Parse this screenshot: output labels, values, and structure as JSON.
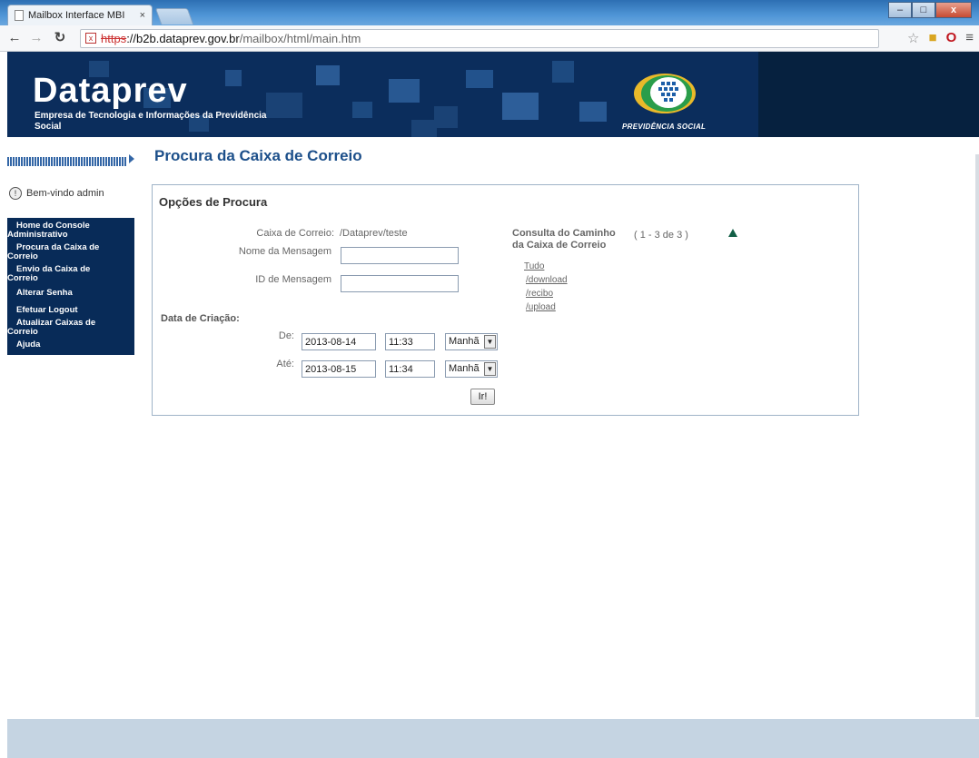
{
  "browser": {
    "tab_title": "Mailbox Interface MBI",
    "tab_close": "×",
    "url_scheme": "https",
    "url_host": "://b2b.dataprev.gov.br",
    "url_path": "/mailbox/html/main.htm",
    "window_controls": [
      "–",
      "□",
      "x"
    ]
  },
  "banner": {
    "brand": "Dataprev",
    "subtitle": "Empresa de Tecnologia e Informações da Previdência Social",
    "partner": "PREVIDÊNCIA SOCIAL"
  },
  "sidebar": {
    "welcome": "Bem-vindo admin",
    "items": [
      {
        "label": "Home do Console Administrativo"
      },
      {
        "label": "Procura da Caixa de Correio"
      },
      {
        "label": "Envio da Caixa de Correio"
      },
      {
        "label": "Alterar Senha"
      },
      {
        "label": "Efetuar Logout"
      },
      {
        "label": "Atualizar Caixas de Correio"
      },
      {
        "label": "Ajuda"
      }
    ]
  },
  "main": {
    "title": "Procura da Caixa de Correio",
    "panel_title": "Opções de Procura",
    "mailbox_label": "Caixa de Correio:",
    "mailbox_value": "/Dataprev/teste",
    "message_name_label": "Nome da Mensagem",
    "message_name_value": "",
    "message_id_label": "ID de Mensagem",
    "message_id_value": "",
    "creation_date_label": "Data de Criação:",
    "from_label": "De:",
    "from_date": "2013-08-14",
    "from_time": "11:33",
    "from_period": "Manhã",
    "to_label": "Até:",
    "to_date": "2013-08-15",
    "to_time": "11:34",
    "to_period": "Manhã",
    "go_button": "Ir!",
    "path_query_label": "Consulta do Caminho da Caixa de Correio",
    "path_count": "( 1 - 3 de 3 )",
    "paths": [
      "Tudo",
      "/download",
      "/recibo",
      "/upload"
    ]
  }
}
